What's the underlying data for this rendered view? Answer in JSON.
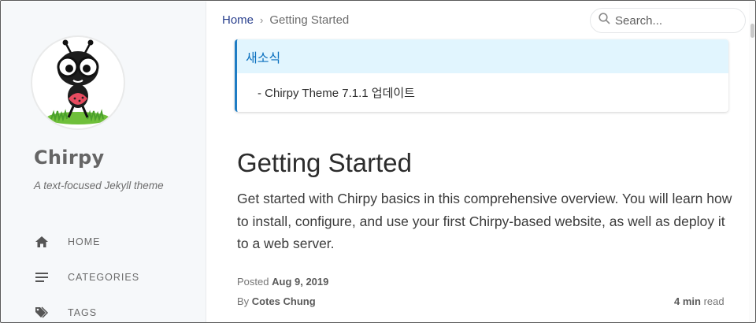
{
  "sidebar": {
    "site_title": "Chirpy",
    "site_subtitle": "A text-focused Jekyll theme",
    "nav": [
      {
        "label": "HOME",
        "icon": "home-icon"
      },
      {
        "label": "CATEGORIES",
        "icon": "categories-icon"
      },
      {
        "label": "TAGS",
        "icon": "tags-icon"
      }
    ]
  },
  "topbar": {
    "breadcrumb_home": "Home",
    "breadcrumb_separator": "›",
    "breadcrumb_current": "Getting Started",
    "search_placeholder": "Search..."
  },
  "notice": {
    "title": "새소식",
    "item": "- Chirpy Theme 7.1.1 업데이트"
  },
  "post": {
    "title": "Getting Started",
    "description": "Get started with Chirpy basics in this comprehensive overview. You will learn how to install, configure, and use your first Chirpy-based website, as well as deploy it to a web server.",
    "posted_label": "Posted",
    "posted_date": "Aug 9, 2019",
    "by_label": "By",
    "author": "Cotes Chung",
    "read_time": "4 min",
    "read_label": "read"
  },
  "colors": {
    "accent": "#2a408e",
    "notice_bg": "#e1f5fe",
    "notice_border": "#1e7cc4",
    "sidebar_bg": "#f6f8fa"
  }
}
